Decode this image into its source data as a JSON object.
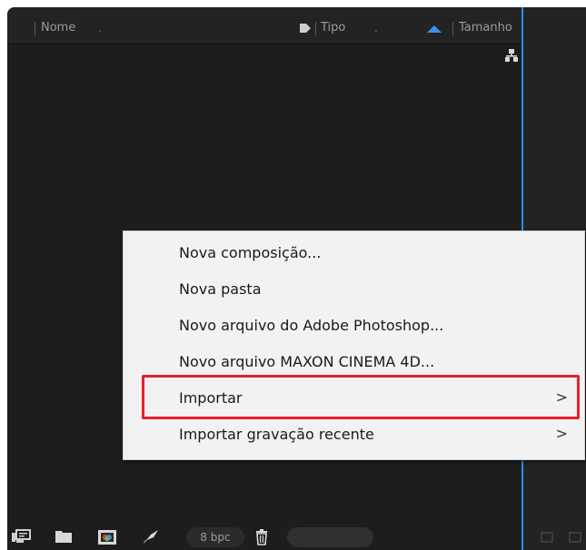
{
  "columns": {
    "name": "Nome",
    "type": "Tipo",
    "size": "Tamanho",
    "dot": "."
  },
  "context_menu": {
    "items": [
      {
        "label": "Nova composição...",
        "has_submenu": false
      },
      {
        "label": "Nova pasta",
        "has_submenu": false
      },
      {
        "label": "Novo arquivo do Adobe Photoshop...",
        "has_submenu": false
      },
      {
        "label": "Novo arquivo MAXON CINEMA 4D...",
        "has_submenu": false
      },
      {
        "label": "Importar",
        "has_submenu": true,
        "highlighted": true
      },
      {
        "label": "Importar gravação recente",
        "has_submenu": true
      }
    ],
    "submenu_arrow": ">"
  },
  "toolbar": {
    "bpc": "8 bpc",
    "icons": [
      "interpret-footage-icon",
      "new-folder-icon",
      "new-composition-icon",
      "project-settings-icon",
      "trash-icon"
    ]
  },
  "colors": {
    "panel_bg": "#1d1d1d",
    "accent_blue": "#2d8ceb",
    "highlight_red": "#e8202a",
    "menu_bg": "#f2f2f2"
  }
}
